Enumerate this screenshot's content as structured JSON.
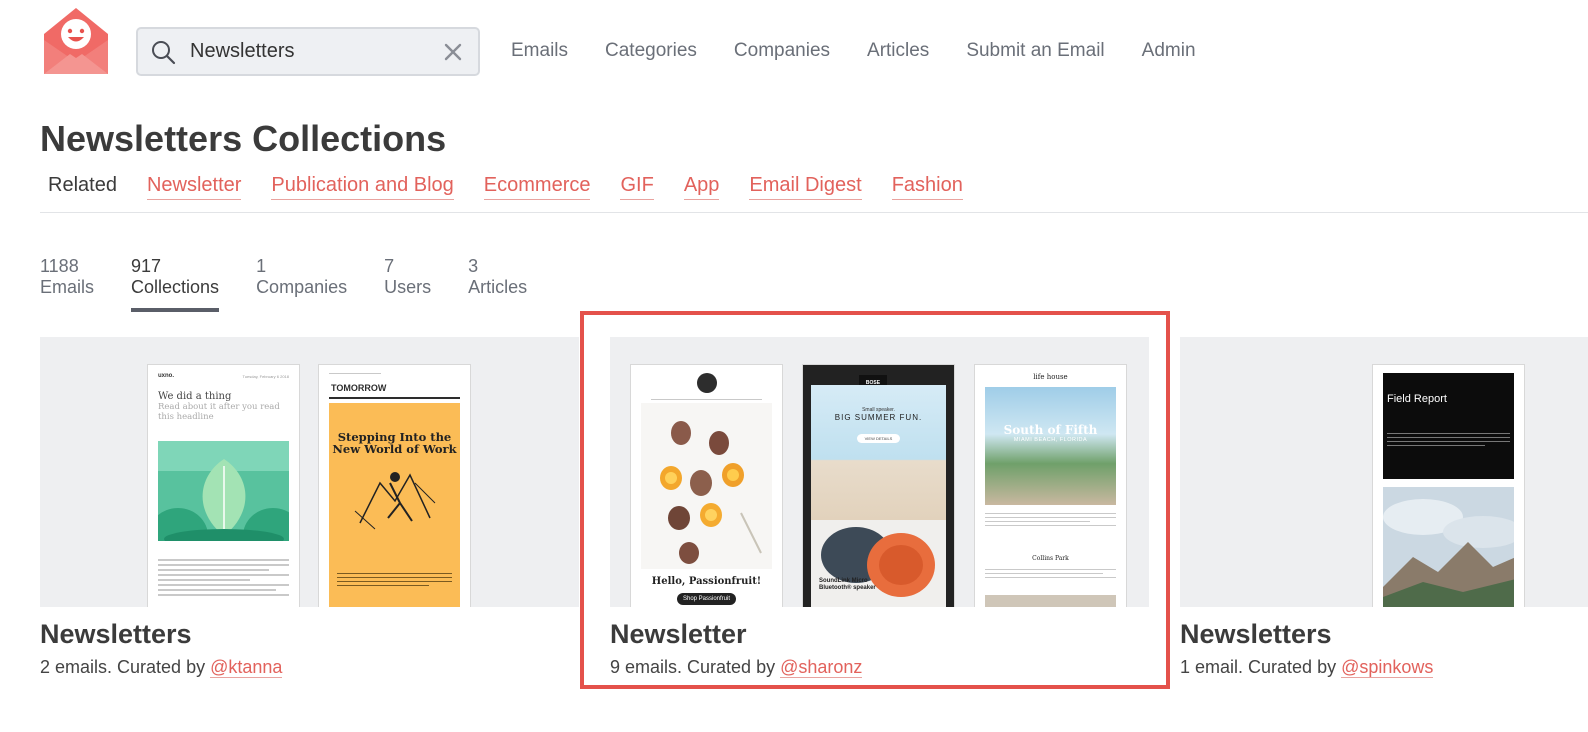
{
  "header": {
    "search": {
      "value": "Newsletters",
      "placeholder": ""
    },
    "nav": [
      "Emails",
      "Categories",
      "Companies",
      "Articles",
      "Submit an Email",
      "Admin"
    ]
  },
  "page": {
    "title": "Newsletters Collections",
    "related_label": "Related",
    "related": [
      "Newsletter",
      "Publication and Blog",
      "Ecommerce",
      "GIF",
      "App",
      "Email Digest",
      "Fashion"
    ]
  },
  "tabs": [
    {
      "count": "1188",
      "label": "Emails",
      "active": false
    },
    {
      "count": "917",
      "label": "Collections",
      "active": true
    },
    {
      "count": "1",
      "label": "Companies",
      "active": false
    },
    {
      "count": "7",
      "label": "Users",
      "active": false
    },
    {
      "count": "3",
      "label": "Articles",
      "active": false
    }
  ],
  "cards": [
    {
      "title": "Newsletters",
      "meta": "2 emails. Curated by ",
      "curator": "@ktanna",
      "thumbs": {
        "a": {
          "brand": "uxno.",
          "date": "Tuesday, February 6 2018",
          "heading": "We did a thing",
          "sub": "Read about it after you read this headline"
        },
        "b": {
          "band": "TOMORROW",
          "title": "Stepping Into the New World of Work"
        }
      }
    },
    {
      "title": "Newsletter",
      "meta": "9 emails. Curated by ",
      "curator": "@sharonz",
      "thumbs": {
        "a": {
          "cta_title": "Hello, Passionfruit!",
          "cta": "Shop Passionfruit"
        },
        "b": {
          "brand": "BOSE",
          "kicker": "Small speaker.",
          "headline": "BIG SUMMER FUN.",
          "cta": "VIEW DETAILS",
          "product": "SoundLink Micro Bluetooth® speaker"
        },
        "c": {
          "brand": "life house",
          "headline": "South of Fifth",
          "place": "MIAMI BEACH, FLORIDA",
          "section": "Collins Park"
        }
      }
    },
    {
      "title": "Newsletters",
      "meta": "1 email. Curated by ",
      "curator": "@spinkows",
      "thumbs": {
        "a": {
          "heading": "Field Report"
        }
      }
    }
  ],
  "colors": {
    "accent": "#e2625c",
    "highlight": "#e4514b",
    "panel": "#eeeff1"
  }
}
